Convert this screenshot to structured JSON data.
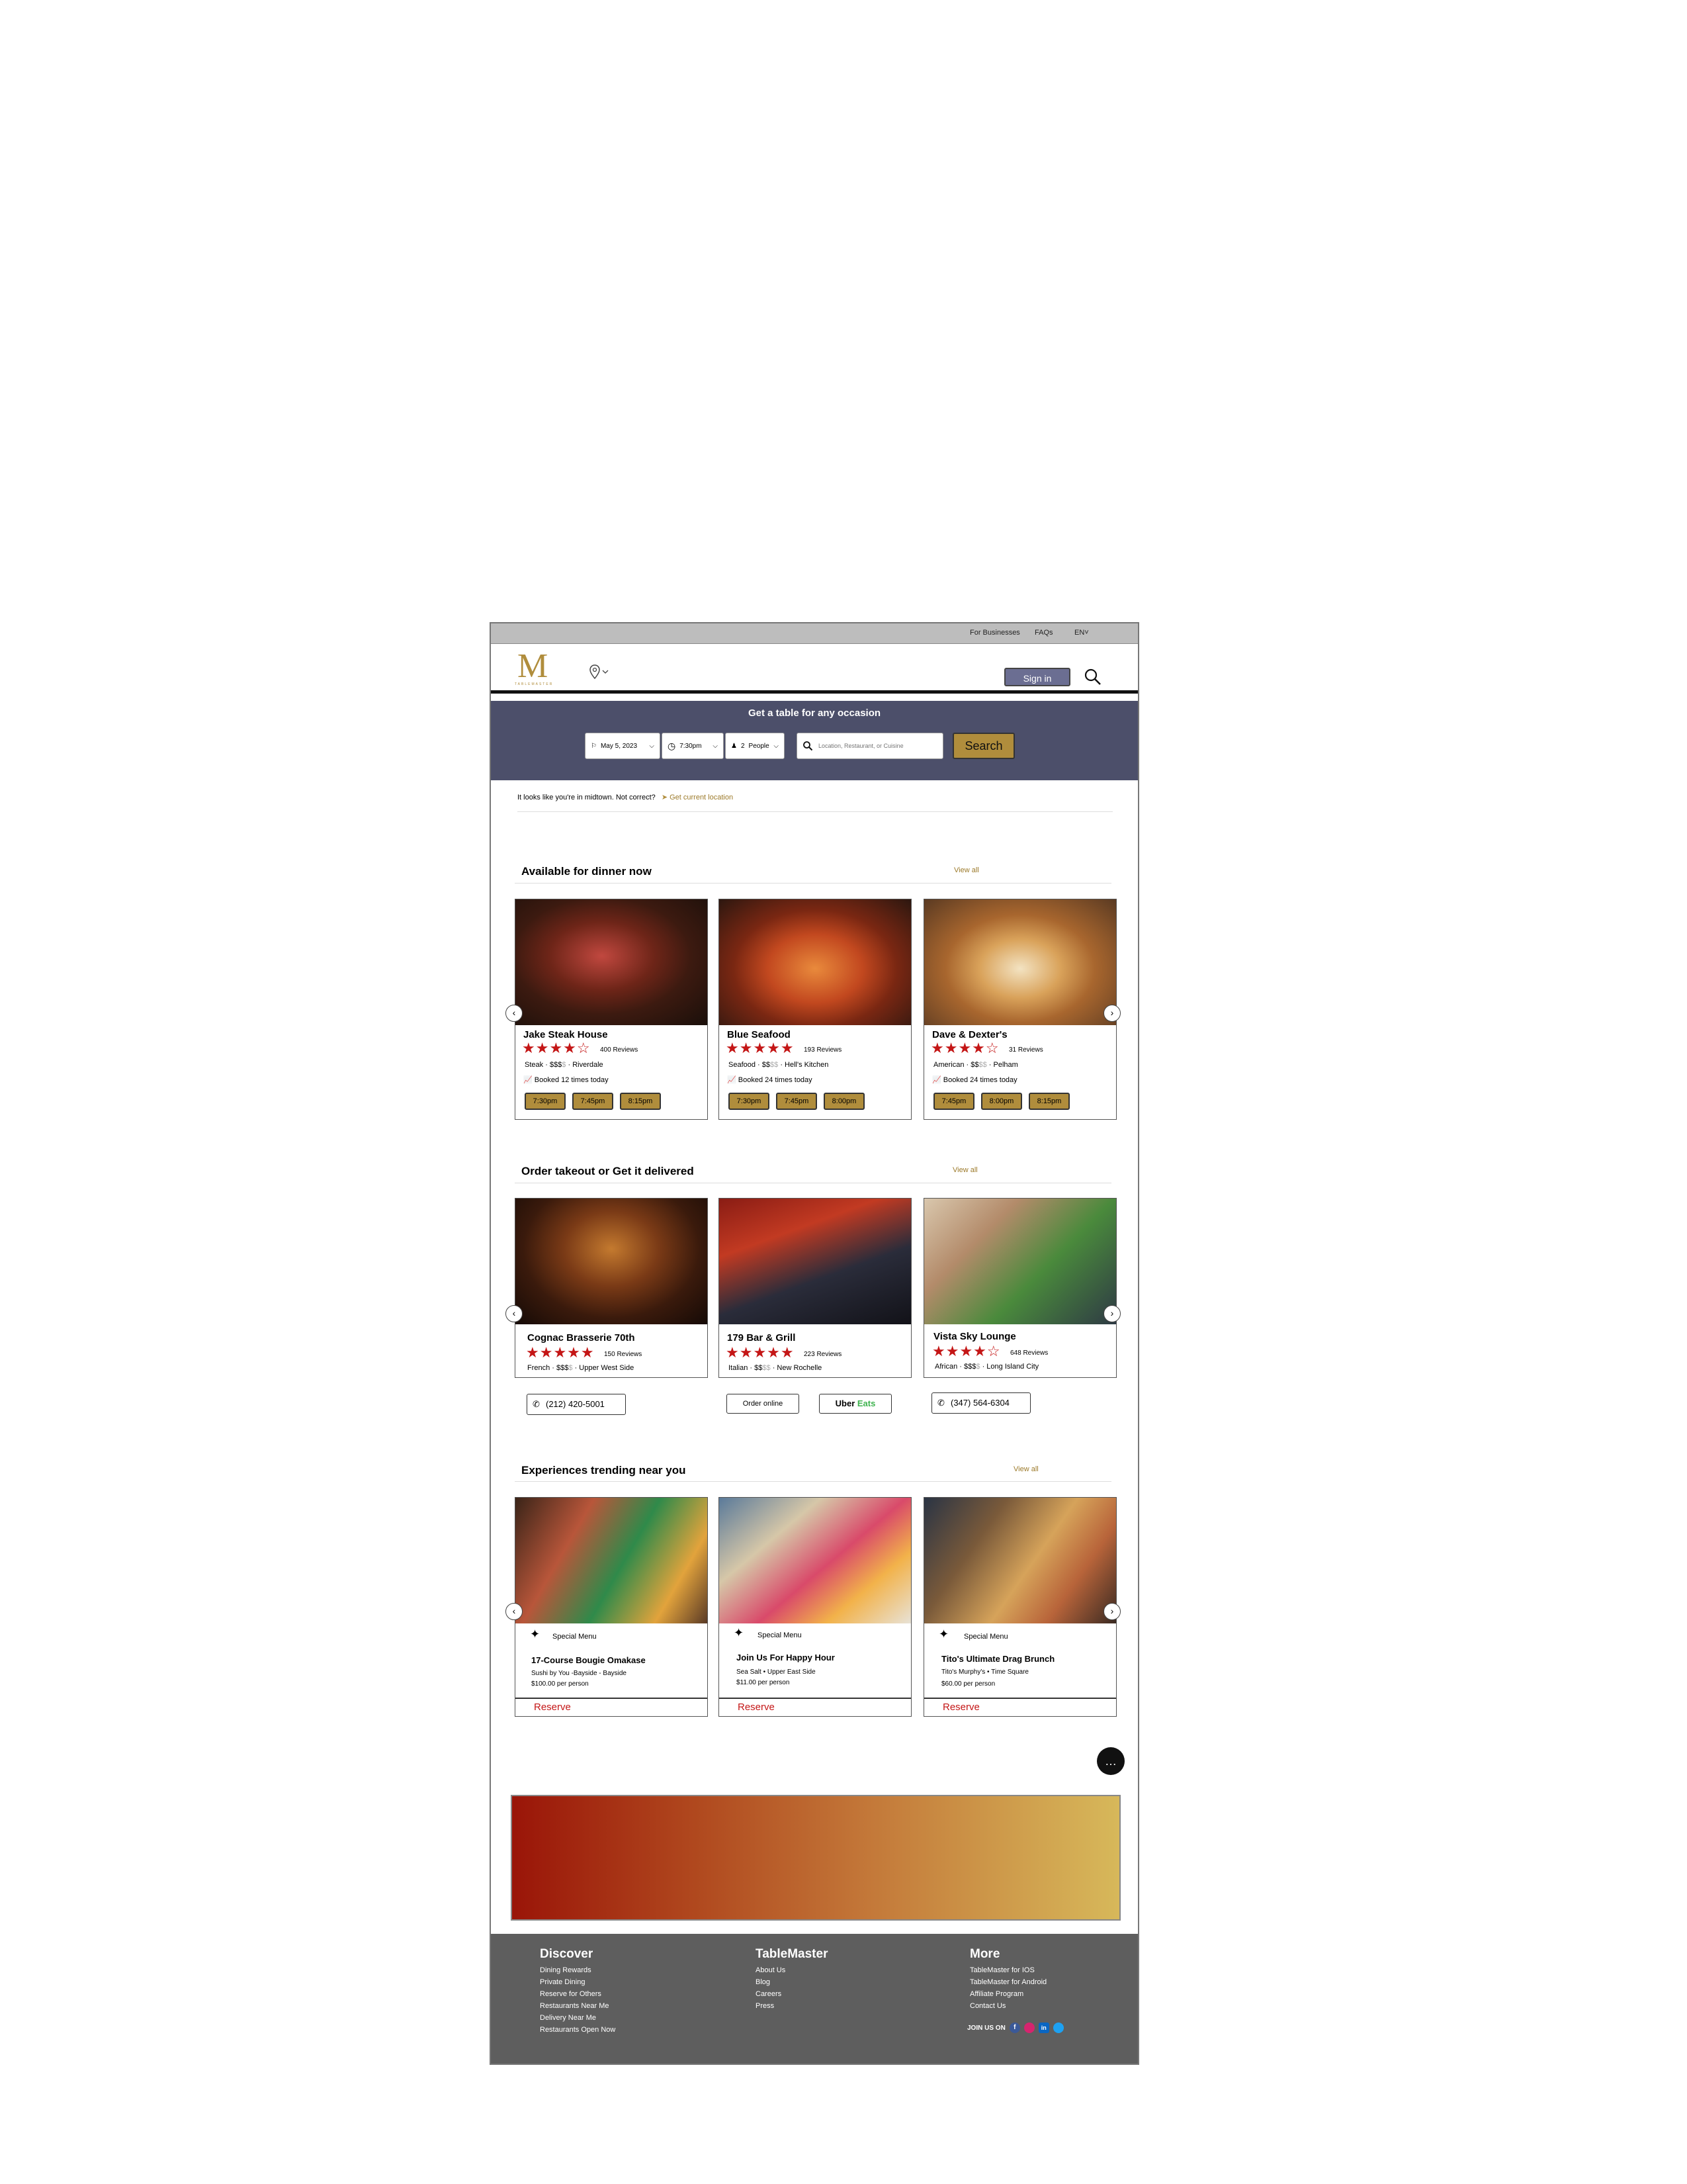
{
  "topbar": {
    "for_businesses": "For Businesses",
    "faqs": "FAQs",
    "lang": "EN"
  },
  "header": {
    "logo_letter": "M",
    "logo_sub": "TABLEMASTER",
    "sign_in": "Sign in"
  },
  "hero": {
    "title": "Get a table for any occasion",
    "date": "May 5, 2023",
    "time": "7:30pm",
    "party_count": "2",
    "party_label": "People",
    "search_placeholder": "Location, Restaurant, or Cuisine",
    "search_button": "Search"
  },
  "location": {
    "text": "It looks like you're in midtown. Not correct?",
    "link": "Get current location"
  },
  "dinner": {
    "title": "Available for dinner now",
    "view_all": "View all",
    "cards": [
      {
        "name": "Jake Steak House",
        "stars": "★★★★☆",
        "reviews": "400 Reviews",
        "cuisine": "Steak",
        "price": "$$$",
        "price_muted": "$",
        "area": "Riverdale",
        "booked": "Booked 12 times today",
        "times": [
          "7:30pm",
          "7:45pm",
          "8:15pm"
        ]
      },
      {
        "name": "Blue Seafood",
        "stars": "★★★★★",
        "reviews": "193 Reviews",
        "cuisine": "Seafood",
        "price": "$$",
        "price_muted": "$$",
        "area": "Hell's Kitchen",
        "booked": "Booked 24 times today",
        "times": [
          "7:30pm",
          "7:45pm",
          "8:00pm"
        ]
      },
      {
        "name": "Dave & Dexter's",
        "stars": "★★★★☆",
        "reviews": "31 Reviews",
        "cuisine": "American",
        "price": "$$",
        "price_muted": "$$",
        "area": "Pelham",
        "booked": "Booked 24 times today",
        "times": [
          "7:45pm",
          "8:00pm",
          "8:15pm"
        ]
      }
    ]
  },
  "takeout": {
    "title": "Order takeout or Get it delivered",
    "view_all": "View all",
    "cards": [
      {
        "name": "Cognac Brasserie 70th",
        "stars": "★★★★★",
        "reviews": "150 Reviews",
        "cuisine": "French",
        "price": "$$$",
        "price_muted": "$",
        "area": "Upper West Side",
        "phone": "(212) 420-5001"
      },
      {
        "name": "179 Bar & Grill",
        "stars": "★★★★★",
        "reviews": "223 Reviews",
        "cuisine": "Italian",
        "price": "$$",
        "price_muted": "$$",
        "area": "New Rochelle",
        "order_online": "Order online",
        "uber": "Uber",
        "eats": "Eats"
      },
      {
        "name": "Vista Sky Lounge",
        "stars": "★★★★☆",
        "reviews": "648 Reviews",
        "cuisine": "African",
        "price": "$$$",
        "price_muted": "$",
        "area": "Long Island City",
        "phone": "(347) 564-6304"
      }
    ]
  },
  "experiences": {
    "title": "Experiences trending near you",
    "view_all": "View all",
    "cards": [
      {
        "tag": "Special Menu",
        "name": "17-Course  Bougie Omakase",
        "line1": "Sushi by You -Bayside - Bayside",
        "line2": "$100.00 per person",
        "reserve": "Reserve"
      },
      {
        "tag": "Special Menu",
        "name": "Join Us For Happy Hour",
        "line1": "Sea Salt • Upper East Side",
        "line2": "$11.00 per person",
        "reserve": "Reserve"
      },
      {
        "tag": "Special Menu",
        "name": "Tito's Ultimate Drag Brunch",
        "line1": "Tito's Murphy's • Time Square",
        "line2": "$60.00 per person",
        "reserve": "Reserve"
      }
    ]
  },
  "footer": {
    "discover": {
      "title": "Discover",
      "links": [
        "Dining Rewards",
        "Private Dining",
        "Reserve for Others",
        "Restaurants Near Me",
        "Delivery Near Me",
        "Restaurants Open Now"
      ]
    },
    "tablemaster": {
      "title": "TableMaster",
      "links": [
        "About Us",
        "Blog",
        "Careers",
        "Press"
      ]
    },
    "more": {
      "title": "More",
      "links": [
        "TableMaster for IOS",
        "TableMaster for Android",
        "Affiliate Program",
        "Contact Us"
      ]
    },
    "join_us": "JOIN US ON"
  },
  "colors": {
    "accent_gold": "#b08d3c",
    "hero_bg": "#4c4f6a",
    "star_red": "#c41616",
    "footer_bg": "#5e5e5e",
    "banner_start": "#9a1508",
    "banner_end": "#d7b85a"
  }
}
